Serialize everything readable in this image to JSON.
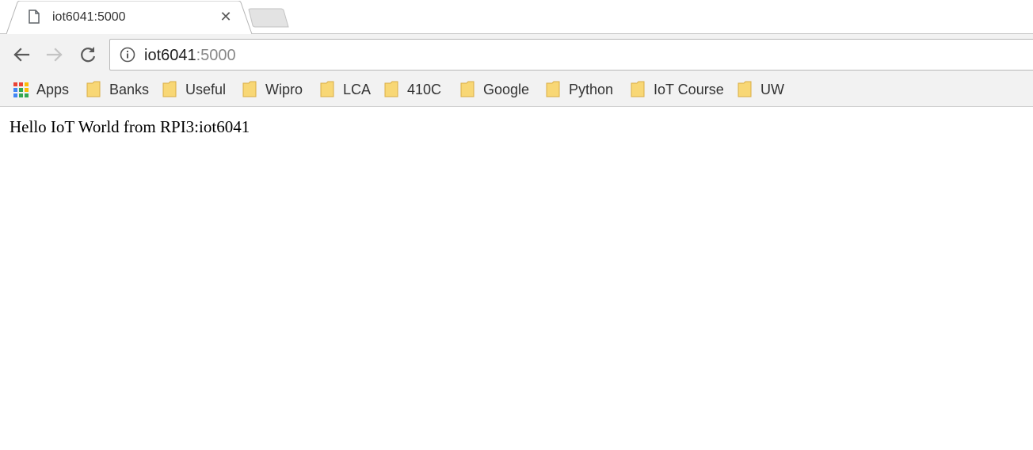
{
  "tab": {
    "title": "iot6041:5000",
    "close_glyph": "✕",
    "icon": "file-icon"
  },
  "toolbar": {
    "back_icon": "arrow-left-icon",
    "forward_icon": "arrow-right-icon",
    "reload_icon": "reload-icon",
    "address": {
      "host": "iot6041",
      "port": ":5000",
      "info_icon": "info-icon"
    }
  },
  "bookmarks": {
    "apps_label": "Apps",
    "items": [
      {
        "label": "Banks"
      },
      {
        "label": "Useful"
      },
      {
        "label": "Wipro"
      },
      {
        "label": "LCA"
      },
      {
        "label": "410C"
      },
      {
        "label": "Google"
      },
      {
        "label": "Python"
      },
      {
        "label": "IoT Course"
      },
      {
        "label": "UW"
      }
    ],
    "folder_icon": "folder-icon"
  },
  "page": {
    "message": "Hello IoT World from RPI3:iot6041"
  },
  "colors": {
    "toolbar_bg": "#f2f2f2",
    "folder_fill": "#f8d775",
    "apps_red": "#ea4335",
    "apps_yellow": "#fbbc05",
    "apps_green": "#34a853",
    "apps_blue": "#4285f4"
  }
}
